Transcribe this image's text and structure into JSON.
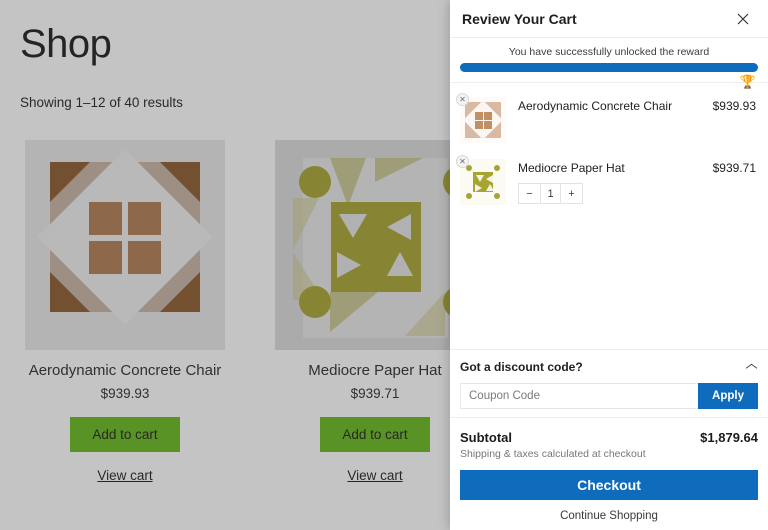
{
  "shop": {
    "title": "Shop",
    "results_text": "Showing 1–12 of 40 results",
    "products": [
      {
        "name": "Aerodynamic Concrete Chair",
        "price": "$939.93",
        "add_label": "Add to cart",
        "view_cart_label": "View cart"
      },
      {
        "name": "Mediocre Paper Hat",
        "price": "$939.71",
        "add_label": "Add to cart",
        "view_cart_label": "View cart"
      }
    ]
  },
  "cart": {
    "title": "Review Your Cart",
    "close_icon": "close-icon",
    "reward": {
      "message": "You have successfully unlocked the reward",
      "progress_percent": 100,
      "bar_color": "#0f6cbd",
      "trophy_icon": "trophy-icon",
      "trophy_color": "#d9b300"
    },
    "items": [
      {
        "name": "Aerodynamic Concrete Chair",
        "price": "$939.93",
        "remove_icon": "close-icon",
        "has_stepper": false
      },
      {
        "name": "Mediocre Paper Hat",
        "price": "$939.71",
        "remove_icon": "close-icon",
        "has_stepper": true,
        "quantity": "1",
        "decrease_label": "−",
        "increase_label": "+"
      }
    ],
    "discount": {
      "label": "Got a discount code?",
      "chevron_icon": "chevron-up-icon",
      "coupon_placeholder": "Coupon Code",
      "coupon_value": "",
      "apply_label": "Apply"
    },
    "totals": {
      "subtotal_label": "Subtotal",
      "subtotal_value": "$1,879.64",
      "note": "Shipping & taxes calculated at checkout"
    },
    "actions": {
      "checkout_label": "Checkout",
      "continue_label": "Continue Shopping"
    }
  },
  "theme": {
    "accent_blue": "#0f6cbd",
    "add_to_cart_green": "#68b91c",
    "overlay_gray": "#b4b4b4"
  }
}
